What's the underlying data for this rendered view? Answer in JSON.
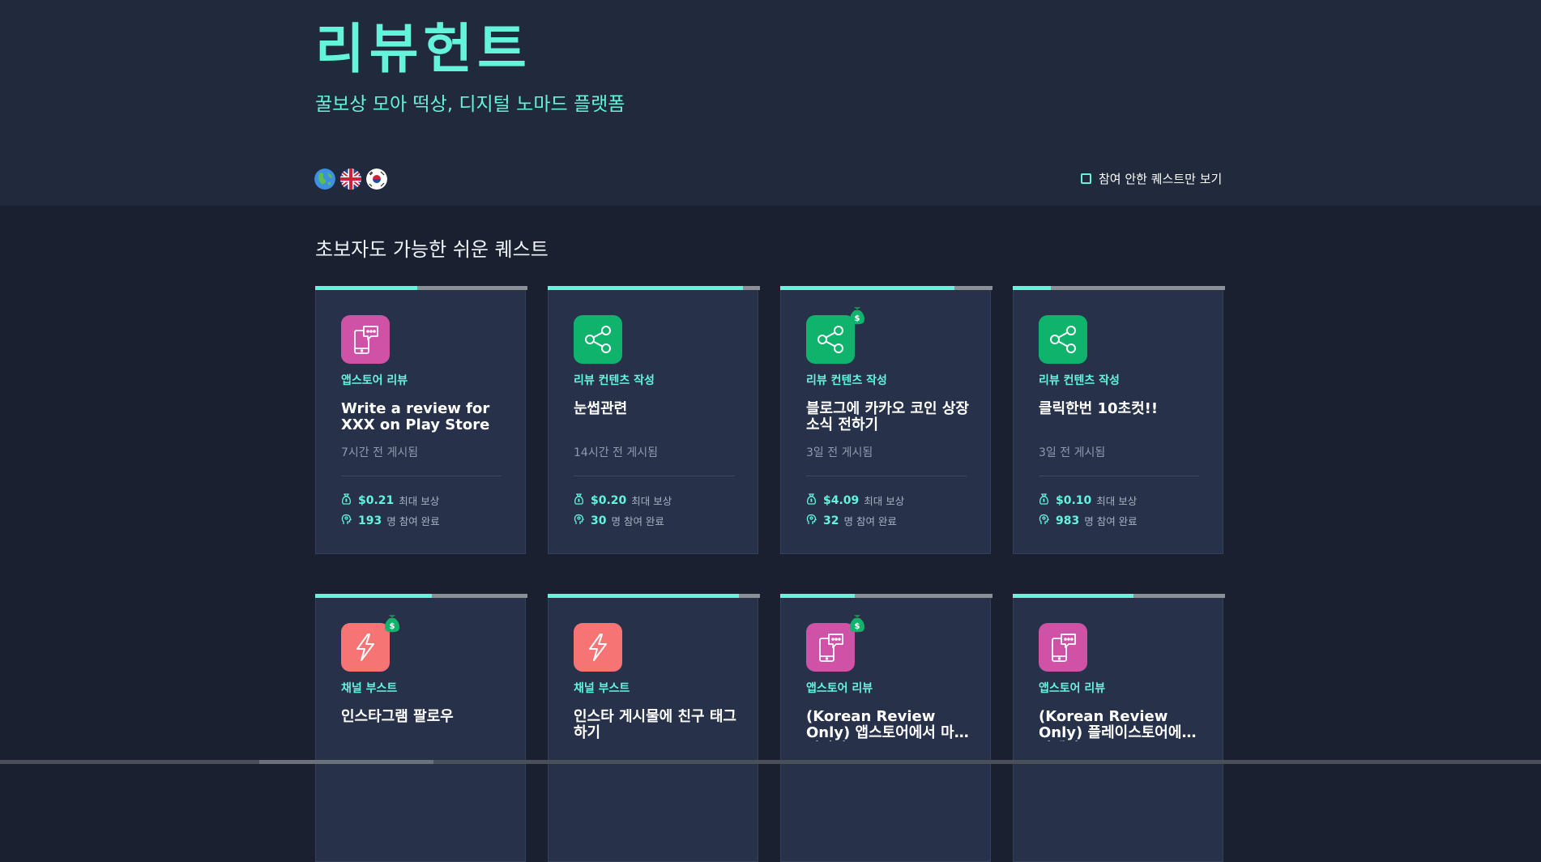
{
  "header": {
    "brand": "리뷰헌트",
    "tagline": "꿀보상 모아 떡상, 디지털 노마드 플랫폼",
    "languages": [
      {
        "name": "global",
        "icon": "globe-icon"
      },
      {
        "name": "english",
        "icon": "uk-flag-icon"
      },
      {
        "name": "korean",
        "icon": "korea-flag-icon"
      }
    ],
    "filter_label": "참여 안한 퀘스트만 보기",
    "filter_checked": false
  },
  "section": {
    "title": "초보자도 가능한 쉬운 퀘스트",
    "reward_label": "최대 보상",
    "participants_label": "명 참여 완료"
  },
  "colors": {
    "accent": "#64f4dc",
    "appstore": "#d052a6",
    "content": "#0fb36c",
    "boost": "#f77474",
    "background": "#1a2030",
    "card": "#27324a"
  },
  "cards": [
    {
      "category": "앱스토어 리뷰",
      "icon": "phone-chat-icon",
      "title": "Write a review for XXX on Play Store",
      "posted": "7시간 전 게시됨",
      "reward": "$0.21",
      "participants": "193",
      "progress": 0.48,
      "money_bag": false
    },
    {
      "category": "리뷰 컨텐츠 작성",
      "icon": "share-icon",
      "title": "눈썹관련",
      "posted": "14시간 전 게시됨",
      "reward": "$0.20",
      "participants": "30",
      "progress": 0.92,
      "money_bag": false
    },
    {
      "category": "리뷰 컨텐츠 작성",
      "icon": "share-icon",
      "title": "블로그에 카카오 코인 상장 소식 전하기",
      "posted": "3일 전 게시됨",
      "reward": "$4.09",
      "participants": "32",
      "progress": 0.82,
      "money_bag": true
    },
    {
      "category": "리뷰 컨텐츠 작성",
      "icon": "share-icon",
      "title": "클릭한번 10초컷!!",
      "posted": "3일 전 게시됨",
      "reward": "$0.10",
      "participants": "983",
      "progress": 0.18,
      "money_bag": false
    },
    {
      "category": "채널 부스트",
      "icon": "lightning-icon",
      "title": "인스타그램 팔로우",
      "posted": "",
      "reward": "",
      "participants": "",
      "progress": 0.55,
      "money_bag": true
    },
    {
      "category": "채널 부스트",
      "icon": "lightning-icon",
      "title": "인스타 게시물에 친구 태그하기",
      "posted": "",
      "reward": "",
      "participants": "",
      "progress": 0.9,
      "money_bag": false
    },
    {
      "category": "앱스토어 리뷰",
      "icon": "phone-chat-icon",
      "title": "(Korean Review Only) 앱스토어에서 마켓빌리지…",
      "posted": "",
      "reward": "",
      "participants": "",
      "progress": 0.35,
      "money_bag": true
    },
    {
      "category": "앱스토어 리뷰",
      "icon": "phone-chat-icon",
      "title": "(Korean Review Only) 플레이스토어에서 마켓빌…",
      "posted": "",
      "reward": "",
      "participants": "",
      "progress": 0.57,
      "money_bag": false
    }
  ]
}
